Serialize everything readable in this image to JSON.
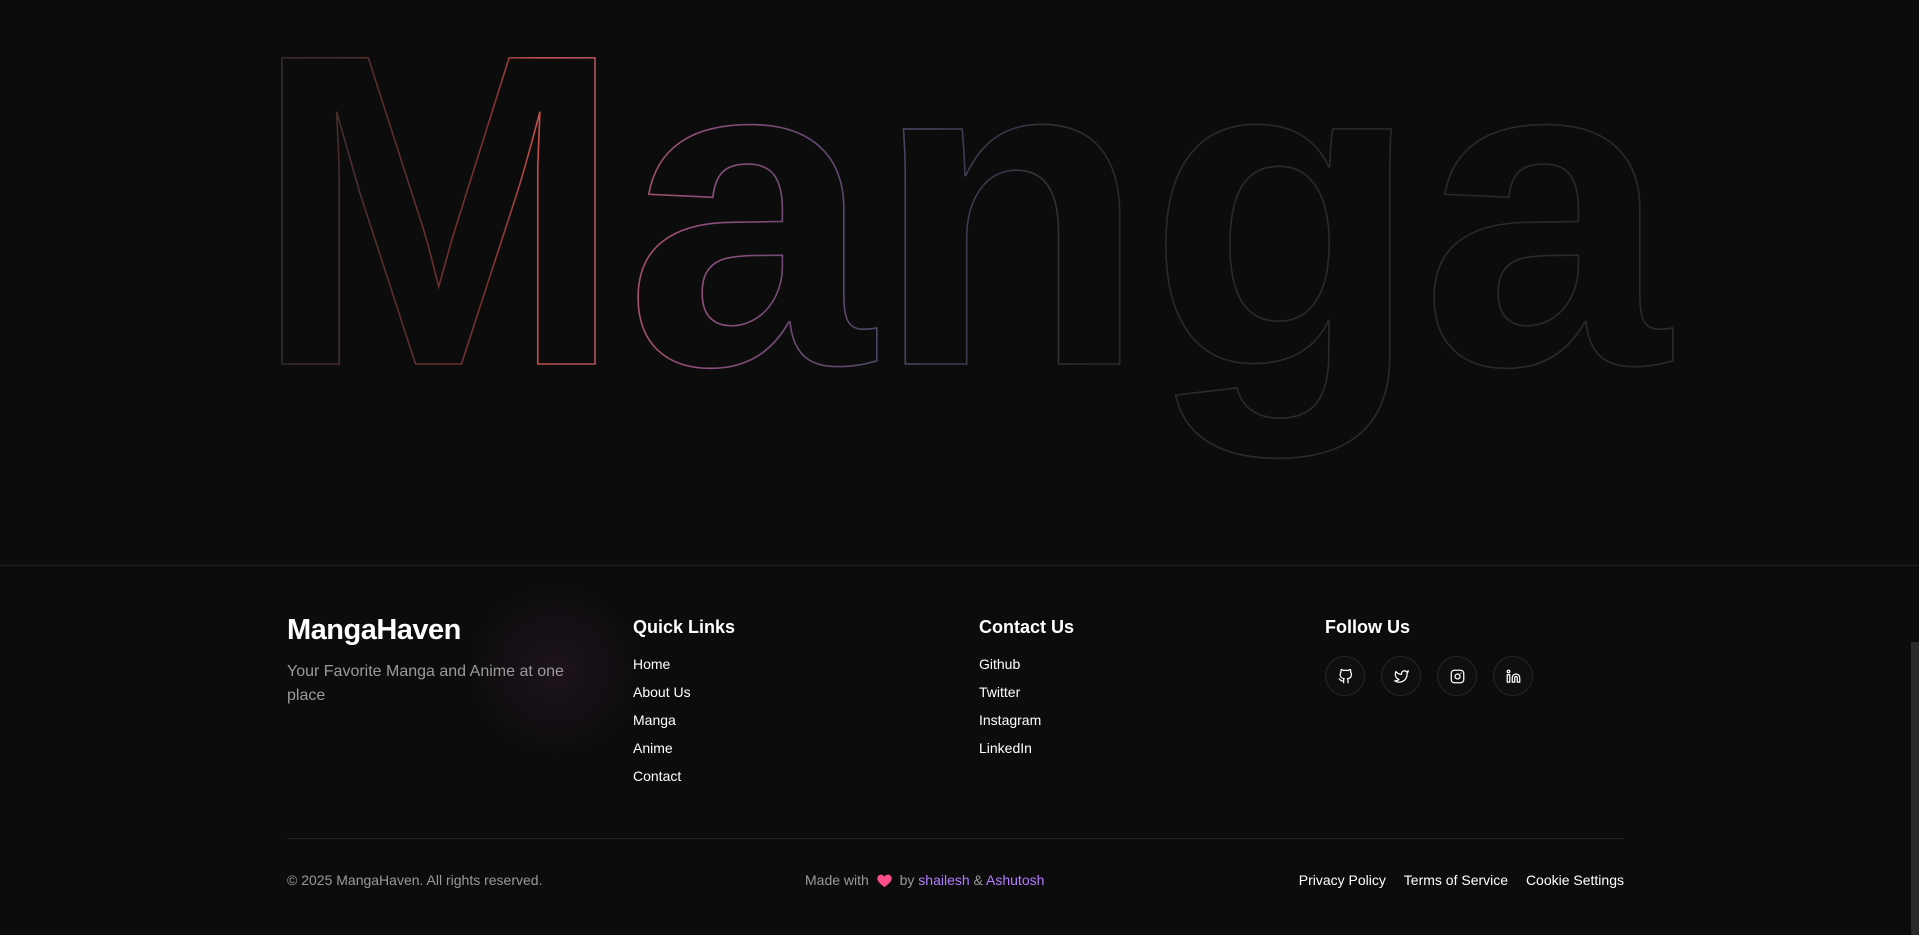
{
  "hero": {
    "word": "Manga"
  },
  "brand": {
    "name": "MangaHaven",
    "tagline": "Your Favorite Manga and Anime at one place"
  },
  "quick_links": {
    "title": "Quick Links",
    "items": [
      "Home",
      "About Us",
      "Manga",
      "Anime",
      "Contact"
    ]
  },
  "contact": {
    "title": "Contact Us",
    "items": [
      "Github",
      "Twitter",
      "Instagram",
      "LinkedIn"
    ]
  },
  "follow": {
    "title": "Follow Us",
    "icons": [
      "github-icon",
      "twitter-icon",
      "instagram-icon",
      "linkedin-icon"
    ]
  },
  "bottom": {
    "copyright": "© 2025 MangaHaven. All rights reserved.",
    "made_with": "Made with",
    "by": "by",
    "author1": "shailesh",
    "amp": "&",
    "author2": "Ashutosh",
    "legal": [
      "Privacy Policy",
      "Terms of Service",
      "Cookie Settings"
    ]
  },
  "colors": {
    "background": "#0c0c0c",
    "accent": "#b47cff",
    "heart": "#ff4f8b",
    "outline_red": "#d9534f",
    "outline_purple": "#7a5ea8"
  }
}
